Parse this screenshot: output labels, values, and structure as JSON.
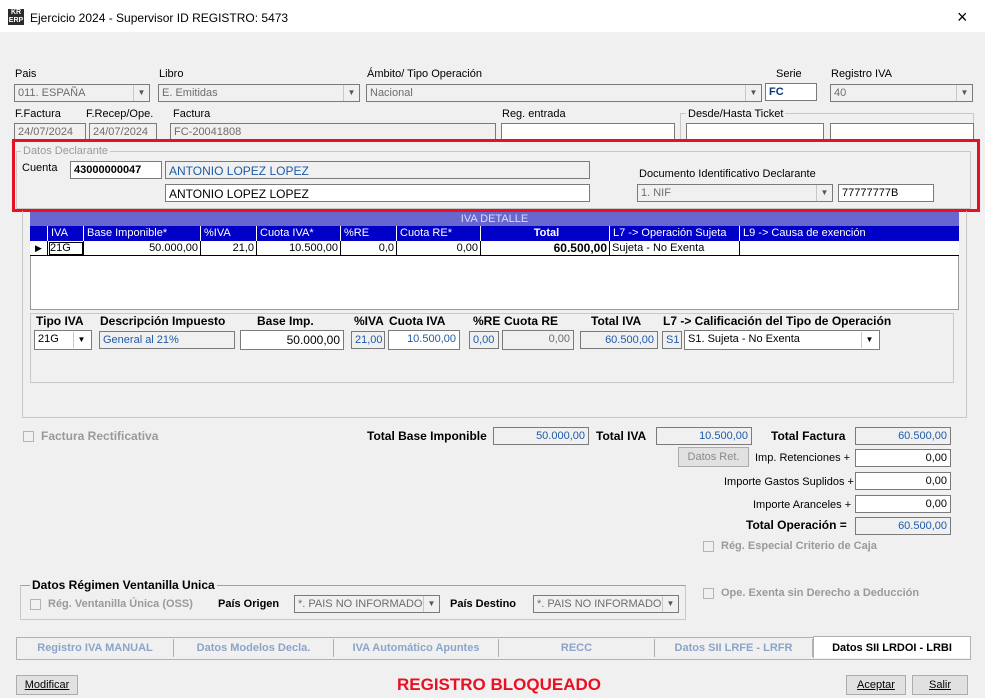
{
  "window": {
    "title": "Ejercicio 2024 - Supervisor ID REGISTRO: 5473",
    "close": "×",
    "icon_text": "KR ERP"
  },
  "header": {
    "pais_label": "Pais",
    "pais_value": "011.  ESPAÑA",
    "libro_label": "Libro",
    "libro_value": "E. Emitidas",
    "ambito_label": "Ámbito/ Tipo Operación",
    "ambito_value": "Nacional",
    "serie_label": "Serie",
    "serie_value": "FC",
    "registro_label": "Registro IVA",
    "registro_value": "40",
    "ffactura_label": "F.Factura",
    "ffactura_value": "24/07/2024",
    "frecep_label": "F.Recep/Ope.",
    "frecep_value": "24/07/2024",
    "factura_label": "Factura",
    "factura_value": "FC-20041808",
    "regentrada_label": "Reg. entrada",
    "regentrada_value": "",
    "ticket_label": "Desde/Hasta Ticket"
  },
  "declarante": {
    "legend": "Datos Declarante",
    "cuenta_label": "Cuenta",
    "cuenta_value": "43000000047",
    "cuenta_name": "ANTONIO LOPEZ LOPEZ",
    "name_value": "ANTONIO LOPEZ LOPEZ",
    "doc_label": "Documento Identificativo Declarante",
    "doc_type": "1. NIF",
    "doc_value": "77777777B"
  },
  "iva_detalle": {
    "title": "IVA DETALLE",
    "columns": [
      "IVA",
      "Base Imponible*",
      "%IVA",
      "Cuota IVA*",
      "%RE",
      "Cuota RE*",
      "Total",
      "L7 -> Operación Sujeta",
      "L9 -> Causa de exención"
    ],
    "row": [
      "21G",
      "50.000,00",
      "21,0",
      "10.500,00",
      "0,0",
      "0,00",
      "60.500,00",
      "Sujeta - No Exenta",
      ""
    ]
  },
  "linea": {
    "tipo_label": "Tipo IVA",
    "desc_label": "Descripción Impuesto",
    "base_label": "Base Imp.",
    "piva_label": "%IVA",
    "cuota_label": "Cuota IVA",
    "pre_label": "%RE",
    "cuotare_label": "Cuota RE",
    "total_label": "Total IVA",
    "l7_label": "L7 -> Calificación del Tipo de Operación",
    "tipo_value": "21G",
    "desc_value": "General al 21%",
    "base_value": "50.000,00",
    "piva_value": "21,00",
    "cuota_value": "10.500,00",
    "pre_value": "0,00",
    "cuotare_value": "0,00",
    "total_value": "60.500,00",
    "l7_code": "S1",
    "l7_value": "S1. Sujeta - No Exenta"
  },
  "totales": {
    "rectificativa_label": "Factura Rectificativa",
    "base_label": "Total Base Imponible",
    "base_value": "50.000,00",
    "iva_label": "Total IVA",
    "iva_value": "10.500,00",
    "factura_label": "Total Factura",
    "factura_value": "60.500,00",
    "datos_ret_btn": "Datos Ret.",
    "retenciones_label": "Imp. Retenciones +",
    "retenciones_value": "0,00",
    "suplidos_label": "Importe Gastos Suplidos +",
    "suplidos_value": "0,00",
    "aranceles_label": "Importe Aranceles +",
    "aranceles_value": "0,00",
    "operacion_label": "Total Operación =",
    "operacion_value": "60.500,00",
    "caja_label": "Rég. Especial Criterio de Caja",
    "exenta_label": "Ope. Exenta sin Derecho a Deducción"
  },
  "ventanilla": {
    "legend": "Datos Régimen Ventanilla Unica",
    "oss_label": "Rég. Ventanilla Única (OSS)",
    "origen_label": "País Origen",
    "origen_value": "*.  PAIS NO INFORMADO",
    "destino_label": "País Destino",
    "destino_value": "*.  PAIS NO INFORMADO"
  },
  "tabs": [
    "Registro IVA MANUAL",
    "Datos Modelos Decla.",
    "IVA Automático Apuntes",
    "RECC",
    "Datos SII  LRFE - LRFR",
    "Datos SII LRDOI - LRBI"
  ],
  "footer": {
    "modificar": "Modificar",
    "status": "REGISTRO BLOQUEADO",
    "aceptar": "Aceptar",
    "salir": "Salir"
  },
  "colors": {
    "accent_red": "#e81123",
    "grid_header": "#0000c8",
    "value_blue": "#1e5aa8"
  }
}
